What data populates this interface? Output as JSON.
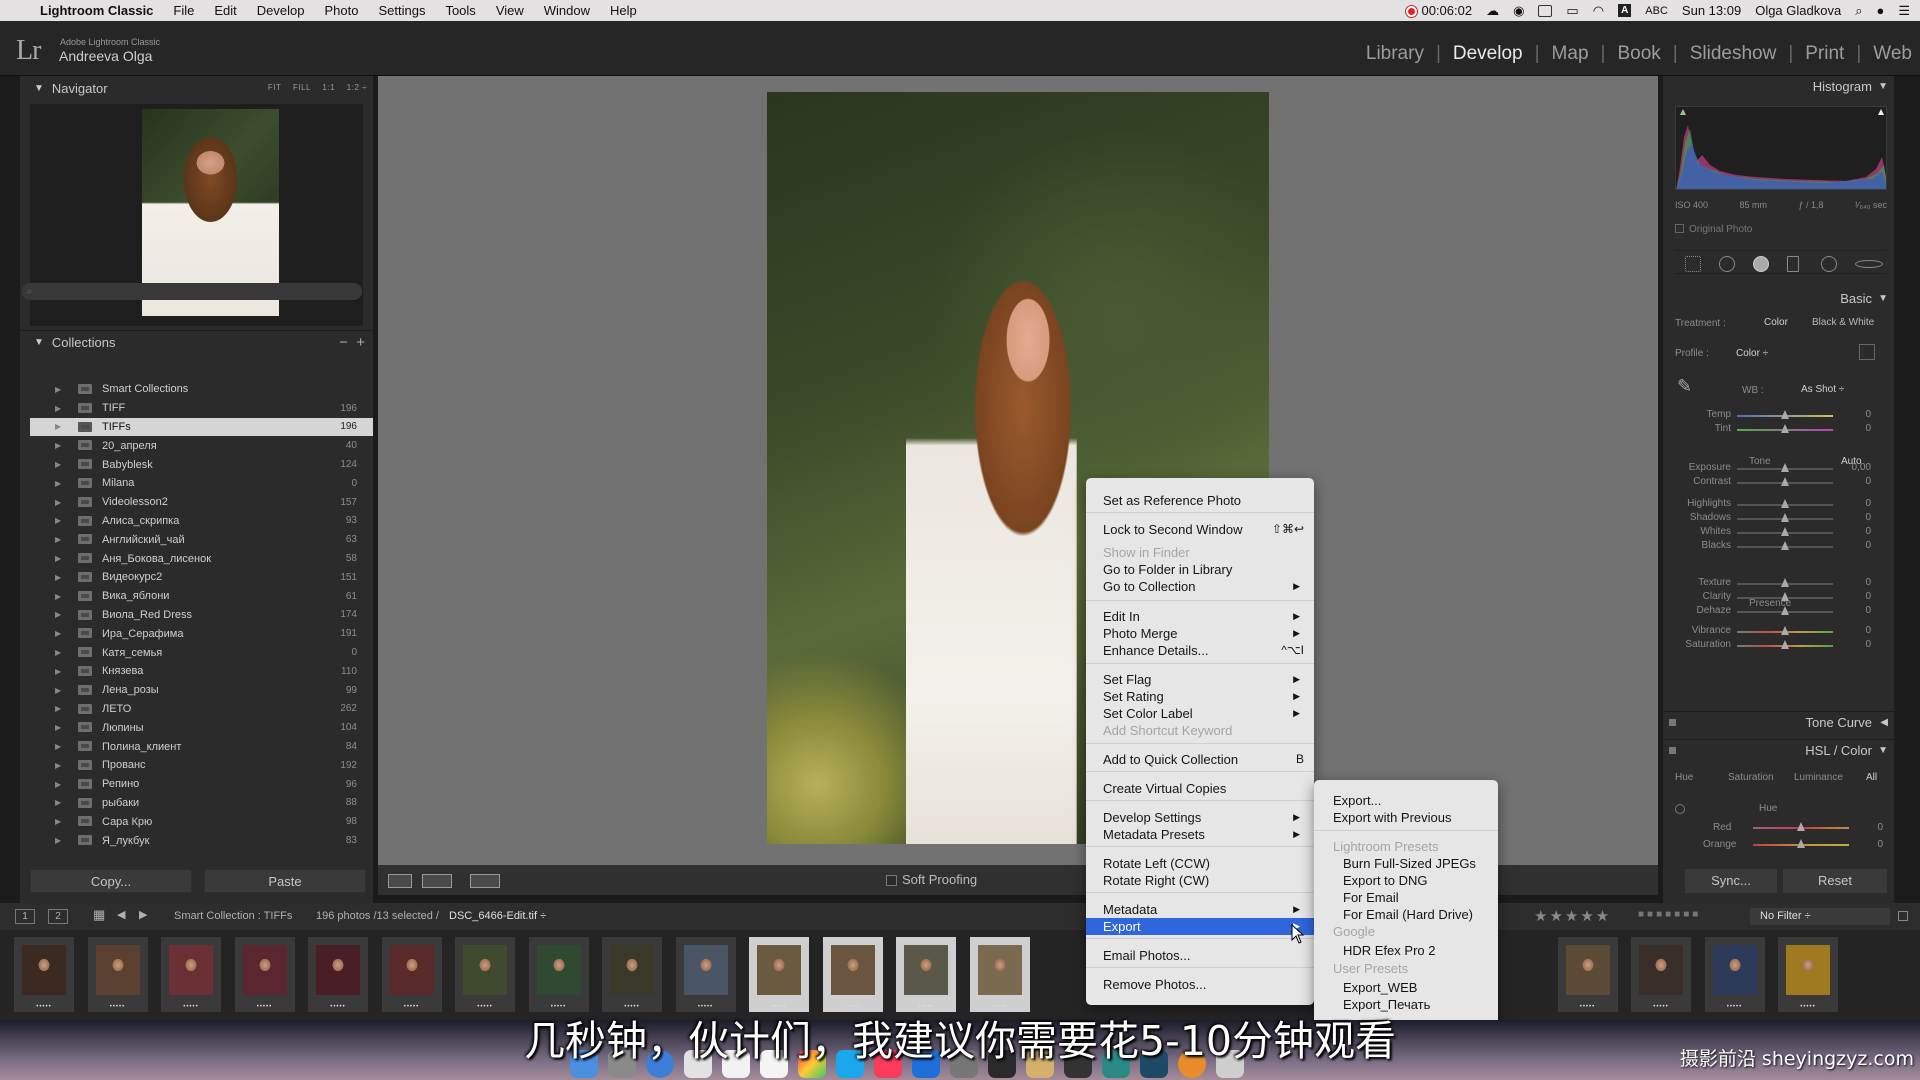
{
  "menubar": {
    "app": "Lightroom Classic",
    "items": [
      "File",
      "Edit",
      "Develop",
      "Photo",
      "Settings",
      "Tools",
      "View",
      "Window",
      "Help"
    ],
    "rec_time": "00:06:02",
    "input": "ABC",
    "time": "Sun 13:09",
    "user": "Olga Gladkova"
  },
  "identity": {
    "logo": "Lr",
    "product": "Adobe Lightroom Classic",
    "owner": "Andreeva Olga"
  },
  "modules": [
    "Library",
    "Develop",
    "Map",
    "Book",
    "Slideshow",
    "Print",
    "Web"
  ],
  "navigator": {
    "title": "Navigator",
    "opts": [
      "FIT",
      "FILL",
      "1:1",
      "1:2 ÷"
    ]
  },
  "collections": {
    "title": "Collections",
    "items": [
      {
        "name": "Smart Collections",
        "count": ""
      },
      {
        "name": "TIFF",
        "count": "196"
      },
      {
        "name": "TIFFs",
        "count": "196"
      },
      {
        "name": "20_апреля",
        "count": "40"
      },
      {
        "name": "Babyblesk",
        "count": "124"
      },
      {
        "name": "Milana",
        "count": "0"
      },
      {
        "name": "Videolesson2",
        "count": "157"
      },
      {
        "name": "Алиса_скрипка",
        "count": "93"
      },
      {
        "name": "Английский_чай",
        "count": "63"
      },
      {
        "name": "Аня_Бокова_лисенок",
        "count": "58"
      },
      {
        "name": "Видеокурс2",
        "count": "151"
      },
      {
        "name": "Вика_яблони",
        "count": "61"
      },
      {
        "name": "Виола_Red Dress",
        "count": "174"
      },
      {
        "name": "Ира_Серафима",
        "count": "191"
      },
      {
        "name": "Катя_семья",
        "count": "0"
      },
      {
        "name": "Князева",
        "count": "110"
      },
      {
        "name": "Лена_розы",
        "count": "99"
      },
      {
        "name": "ЛЕТО",
        "count": "262"
      },
      {
        "name": "Люпины",
        "count": "104"
      },
      {
        "name": "Полина_клиент",
        "count": "84"
      },
      {
        "name": "Прованс",
        "count": "192"
      },
      {
        "name": "Репино",
        "count": "96"
      },
      {
        "name": "рыбаки",
        "count": "88"
      },
      {
        "name": "Сара Крю",
        "count": "98"
      },
      {
        "name": "Я_лукбук",
        "count": "83"
      }
    ],
    "selected_index": 2
  },
  "left_buttons": {
    "copy": "Copy...",
    "paste": "Paste"
  },
  "toolbar": {
    "soft_proofing": "Soft Proofing"
  },
  "histogram": {
    "title": "Histogram",
    "iso": "ISO 400",
    "focal": "85 mm",
    "aperture": "ƒ / 1,8",
    "shutter": "¹⁄₆₄₀ sec",
    "original": "Original Photo"
  },
  "basic": {
    "title": "Basic",
    "treatment_label": "Treatment :",
    "treatment_color": "Color",
    "treatment_bw": "Black & White",
    "profile_label": "Profile :",
    "profile_value": "Color ÷",
    "wb_label": "WB :",
    "wb_value": "As Shot ÷",
    "tone_label": "Tone",
    "auto": "Auto",
    "presence_label": "Presence",
    "sliders": [
      {
        "label": "Temp",
        "value": "0"
      },
      {
        "label": "Tint",
        "value": "0"
      },
      {
        "label": "Exposure",
        "value": "0,00"
      },
      {
        "label": "Contrast",
        "value": "0"
      },
      {
        "label": "Highlights",
        "value": "0"
      },
      {
        "label": "Shadows",
        "value": "0"
      },
      {
        "label": "Whites",
        "value": "0"
      },
      {
        "label": "Blacks",
        "value": "0"
      },
      {
        "label": "Texture",
        "value": "0"
      },
      {
        "label": "Clarity",
        "value": "0"
      },
      {
        "label": "Dehaze",
        "value": "0"
      },
      {
        "label": "Vibrance",
        "value": "0"
      },
      {
        "label": "Saturation",
        "value": "0"
      }
    ]
  },
  "tone_curve": {
    "title": "Tone Curve"
  },
  "hsl": {
    "title": "HSL / Color",
    "tabs": [
      "Hue",
      "Saturation",
      "Luminance",
      "All"
    ],
    "hue_label": "Hue",
    "rows": [
      {
        "label": "Red",
        "value": "0"
      },
      {
        "label": "Orange",
        "value": "0"
      }
    ]
  },
  "right_buttons": {
    "sync": "Sync...",
    "reset": "Reset"
  },
  "filmstrip": {
    "page1": "1",
    "page2": "2",
    "source": "Smart Collection : TIFFs",
    "summary": "196 photos /13 selected /",
    "file": "DSC_6466-Edit.tif ÷",
    "filter": "No Filter ÷"
  },
  "context_menu": {
    "items": [
      {
        "label": "Set as Reference Photo"
      },
      {
        "label": "Lock to Second Window",
        "shortcut": "⇧⌘↩"
      },
      {
        "label": "Show in Finder",
        "disabled": true
      },
      {
        "label": "Go to Folder in Library"
      },
      {
        "label": "Go to Collection",
        "submenu": true
      },
      {
        "label": "Edit In",
        "submenu": true
      },
      {
        "label": "Photo Merge",
        "submenu": true
      },
      {
        "label": "Enhance Details...",
        "shortcut": "^⌥I"
      },
      {
        "label": "Set Flag",
        "submenu": true
      },
      {
        "label": "Set Rating",
        "submenu": true
      },
      {
        "label": "Set Color Label",
        "submenu": true
      },
      {
        "label": "Add Shortcut Keyword",
        "disabled": true
      },
      {
        "label": "Add to Quick Collection",
        "shortcut": "B"
      },
      {
        "label": "Create Virtual Copies"
      },
      {
        "label": "Develop Settings",
        "submenu": true
      },
      {
        "label": "Metadata Presets",
        "submenu": true
      },
      {
        "label": "Rotate Left (CCW)"
      },
      {
        "label": "Rotate Right (CW)"
      },
      {
        "label": "Metadata",
        "submenu": true
      },
      {
        "label": "Export",
        "submenu": true,
        "highlighted": true
      },
      {
        "label": "Email Photos..."
      },
      {
        "label": "Remove Photos..."
      }
    ]
  },
  "export_submenu": {
    "items": [
      {
        "label": "Export..."
      },
      {
        "label": "Export with Previous"
      },
      {
        "label": "Lightroom Presets",
        "header": true
      },
      {
        "label": "Burn Full-Sized JPEGs"
      },
      {
        "label": "Export to DNG"
      },
      {
        "label": "For Email"
      },
      {
        "label": "For Email (Hard Drive)"
      },
      {
        "label": "Google",
        "header": true
      },
      {
        "label": "HDR Efex Pro 2"
      },
      {
        "label": "User Presets",
        "header": true
      },
      {
        "label": "Export_WEB"
      },
      {
        "label": "Export_Печать"
      }
    ]
  },
  "subtitle": "几秒钟，伙计们，我建议你需要花5-10分钟观看",
  "watermark": "摄影前沿 sheyingzyz.com",
  "colors": {
    "menu_highlight": "#2f66db",
    "panel": "#2b2b2b",
    "canvas": "#727272"
  }
}
